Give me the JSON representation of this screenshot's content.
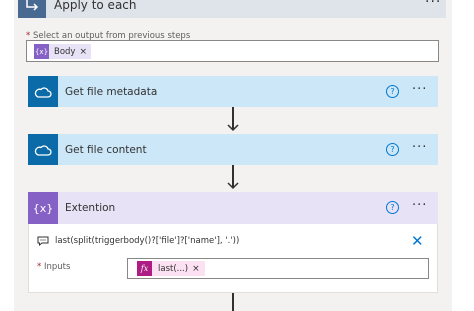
{
  "apply_to_each": {
    "title": "Apply to each",
    "more": "···"
  },
  "select_output": {
    "required_mark": "*",
    "label": "Select an output from previous steps",
    "token": {
      "icon": "{x}",
      "label": "Body",
      "remove": "×"
    }
  },
  "actions": [
    {
      "title": "Get file metadata",
      "icon": "onedrive-cloud-icon",
      "help": "?",
      "more": "···"
    },
    {
      "title": "Get file content",
      "icon": "onedrive-cloud-icon",
      "help": "?",
      "more": "···"
    },
    {
      "title": "Extention",
      "icon": "{x}",
      "help": "?",
      "more": "···"
    }
  ],
  "compose": {
    "expression": "last(split(triggerbody()?['file']?['name'], '.'))",
    "inputs_required_mark": "*",
    "inputs_label": "Inputs",
    "token": {
      "icon": "fx",
      "label": "last(...)",
      "remove": "×"
    },
    "close": "✕"
  },
  "colors": {
    "onedrive_card": "#cce7f7",
    "onedrive_icon": "#0b6aa8",
    "compose_card": "#e8e2f7",
    "compose_icon": "#8661c5",
    "expression_token": "#ad1d83",
    "apply_icon": "#486991",
    "accent": "#0078d4"
  }
}
